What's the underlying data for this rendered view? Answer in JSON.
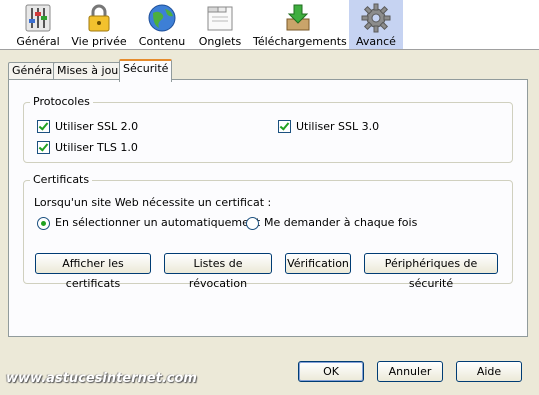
{
  "toolbar": {
    "items": [
      {
        "label": "Général",
        "icon": "sliders-icon"
      },
      {
        "label": "Vie privée",
        "icon": "padlock-icon"
      },
      {
        "label": "Contenu",
        "icon": "globe-icon"
      },
      {
        "label": "Onglets",
        "icon": "tabs-icon"
      },
      {
        "label": "Téléchargements",
        "icon": "download-icon"
      },
      {
        "label": "Avancé",
        "icon": "gear-icon",
        "selected": true
      }
    ]
  },
  "tabs": [
    {
      "label": "Général",
      "active": false
    },
    {
      "label": "Mises à jour",
      "active": false
    },
    {
      "label": "Sécurité",
      "active": true
    }
  ],
  "protocoles": {
    "legend": "Protocoles",
    "ssl2": {
      "label": "Utiliser SSL 2.0",
      "checked": true
    },
    "ssl3": {
      "label": "Utiliser SSL 3.0",
      "checked": true
    },
    "tls1": {
      "label": "Utiliser TLS 1.0",
      "checked": true
    }
  },
  "certificats": {
    "legend": "Certificats",
    "prompt": "Lorsqu'un site Web nécessite un certificat :",
    "radio_auto": {
      "label": "En sélectionner un automatiquement",
      "selected": true
    },
    "radio_ask": {
      "label": "Me demander à chaque fois",
      "selected": false
    },
    "buttons": {
      "show": "Afficher les certificats",
      "revocation": "Listes de révocation",
      "verification": "Vérification",
      "devices": "Périphériques de sécurité"
    }
  },
  "dialog": {
    "ok": "OK",
    "cancel": "Annuler",
    "help": "Aide"
  },
  "watermark": "www.astucesinternet.com"
}
